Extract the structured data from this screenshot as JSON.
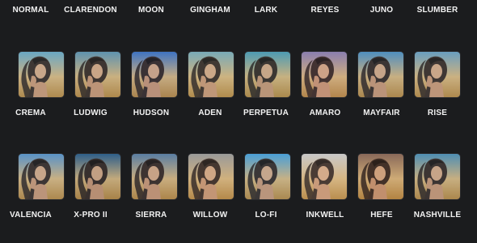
{
  "filters": {
    "labels_row_1": [
      "NORMAL",
      "CLARENDON",
      "MOON",
      "GINGHAM",
      "LARK",
      "REYES",
      "JUNO",
      "SLUMBER"
    ],
    "labels_row_2": [
      "CREMA",
      "LUDWIG",
      "HUDSON",
      "ADEN",
      "PERPETUA",
      "AMARO",
      "MAYFAIR",
      "RISE"
    ],
    "labels_row_3": [
      "VALENCIA",
      "X-PRO II",
      "SIERRA",
      "WILLOW",
      "LO-FI",
      "INKWELL",
      "HEFE",
      "NASHVILLE"
    ]
  },
  "thumbnail_tints": {
    "row_1": [
      "#6aa8c4",
      "#5f93b0",
      "#3f74c2",
      "#79aab8",
      "#4e9bb3",
      "#8a7fb0",
      "#4f8fbf",
      "#6a9fc0"
    ],
    "row_2": [
      "#5a93c8",
      "#2f5f8a",
      "#5b7fa3",
      "#9a9a9a",
      "#4aa0d8",
      "#c9c9c9",
      "#8a6a5a",
      "#4f8fb3"
    ]
  }
}
